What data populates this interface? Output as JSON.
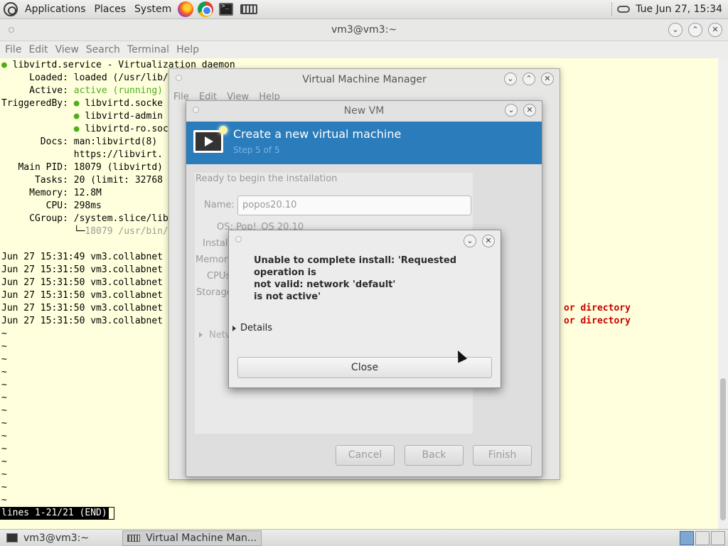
{
  "top_panel": {
    "menus": [
      "Applications",
      "Places",
      "System"
    ],
    "launchers": [
      "firefox-icon",
      "chrome-icon",
      "terminal-icon",
      "virt-manager-icon"
    ],
    "clock": "Tue Jun 27, 15:34"
  },
  "terminal": {
    "title": "vm3@vm3:~",
    "menu": [
      "File",
      "Edit",
      "View",
      "Search",
      "Terminal",
      "Help"
    ],
    "lines": [
      {
        "bullet": "●",
        "text": " libvirtd.service - Virtualization daemon"
      },
      {
        "text": "     Loaded: loaded (/usr/lib/"
      },
      {
        "prefix": "     Active: ",
        "green": "active (running)"
      },
      {
        "prefix": "TriggeredBy: ",
        "bullet": "●",
        "text": " libvirtd.socke"
      },
      {
        "prefix": "             ",
        "bullet": "●",
        "text": " libvirtd-admin"
      },
      {
        "prefix": "             ",
        "bullet": "●",
        "text": " libvirtd-ro.soc"
      },
      {
        "text": "       Docs: man:libvirtd(8)"
      },
      {
        "text": "             https://libvirt."
      },
      {
        "text": "   Main PID: 18079 (libvirtd)"
      },
      {
        "text": "      Tasks: 20 (limit: 32768"
      },
      {
        "text": "     Memory: 12.8M"
      },
      {
        "text": "        CPU: 298ms"
      },
      {
        "text": "     CGroup: /system.slice/lib"
      },
      {
        "prefix": "             └─",
        "grey": "18079 /usr/bin/"
      },
      {
        "text": ""
      },
      {
        "text": "Jun 27 15:31:49 vm3.collabnet"
      },
      {
        "text": "Jun 27 15:31:50 vm3.collabnet"
      },
      {
        "text": "Jun 27 15:31:50 vm3.collabnet"
      },
      {
        "text": "Jun 27 15:31:50 vm3.collabnet"
      },
      {
        "text": "Jun 27 15:31:50 vm3.collabnet",
        "red": "or directory"
      },
      {
        "text": "Jun 27 15:31:50 vm3.collabnet",
        "red": "or directory"
      }
    ],
    "tilde": "~",
    "tilde_count": 14,
    "pager_status": "lines 1-21/21 (END)"
  },
  "vmm": {
    "title": "Virtual Machine Manager",
    "menu": [
      "File",
      "Edit",
      "View",
      "Help"
    ]
  },
  "newvm": {
    "title": "New VM",
    "heading": "Create a new virtual machine",
    "step": "Step 5 of 5",
    "ready_label": "Ready to begin the installation",
    "name_label": "Name:",
    "name_value": "popos20.10",
    "os_label": "OS:",
    "os_value": "Pop!_OS 20.10",
    "install_label": "Install",
    "memory_label": "Memory",
    "cpus_label": "CPUs",
    "storage_label": "Storage",
    "network_label": "Netw",
    "buttons": {
      "cancel": "Cancel",
      "back": "Back",
      "finish": "Finish"
    }
  },
  "error_dialog": {
    "message_line1": "Unable to complete install: 'Requested operation is",
    "message_line2": "not valid: network 'default'",
    "message_line3": "is not active'",
    "details": "Details",
    "close": "Close"
  },
  "taskbar": {
    "items": [
      {
        "label": "vm3@vm3:~",
        "icon": "terminal-icon"
      },
      {
        "label": "Virtual Machine Man...",
        "icon": "virt-manager-icon"
      }
    ]
  }
}
